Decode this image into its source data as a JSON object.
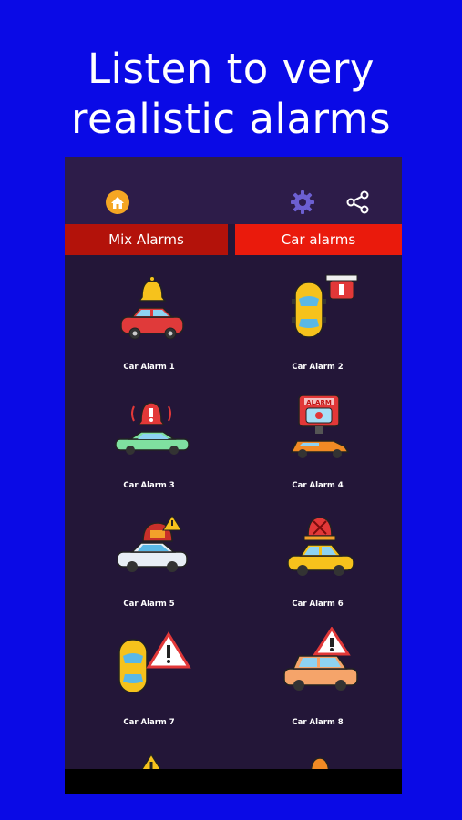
{
  "headline": {
    "line1": "Listen to very",
    "line2": "realistic alarms"
  },
  "appbar": {
    "home_icon": "home-icon",
    "settings_icon": "gear-icon",
    "share_icon": "share-icon"
  },
  "tabs": [
    {
      "label": "Mix Alarms",
      "active": false,
      "color": "#b3120a"
    },
    {
      "label": "Car alarms",
      "active": true,
      "color": "#ea1a0c"
    }
  ],
  "alarms": [
    {
      "label": "Car Alarm 1",
      "icon": "red-car-bell-icon"
    },
    {
      "label": "Car Alarm 2",
      "icon": "yellow-car-siren-icon"
    },
    {
      "label": "Car Alarm 3",
      "icon": "green-car-bell-icon"
    },
    {
      "label": "Car Alarm 4",
      "icon": "orange-car-alarm-sign-icon"
    },
    {
      "label": "Car Alarm 5",
      "icon": "white-car-warning-icon"
    },
    {
      "label": "Car Alarm 6",
      "icon": "yellow-car-beacon-icon"
    },
    {
      "label": "Car Alarm 7",
      "icon": "yellow-car-triangle-icon"
    },
    {
      "label": "Car Alarm 8",
      "icon": "orange-suv-triangle-icon"
    }
  ],
  "colors": {
    "background": "#0a0ae6",
    "app_background": "#231638",
    "appbar": "#2d1c49"
  }
}
